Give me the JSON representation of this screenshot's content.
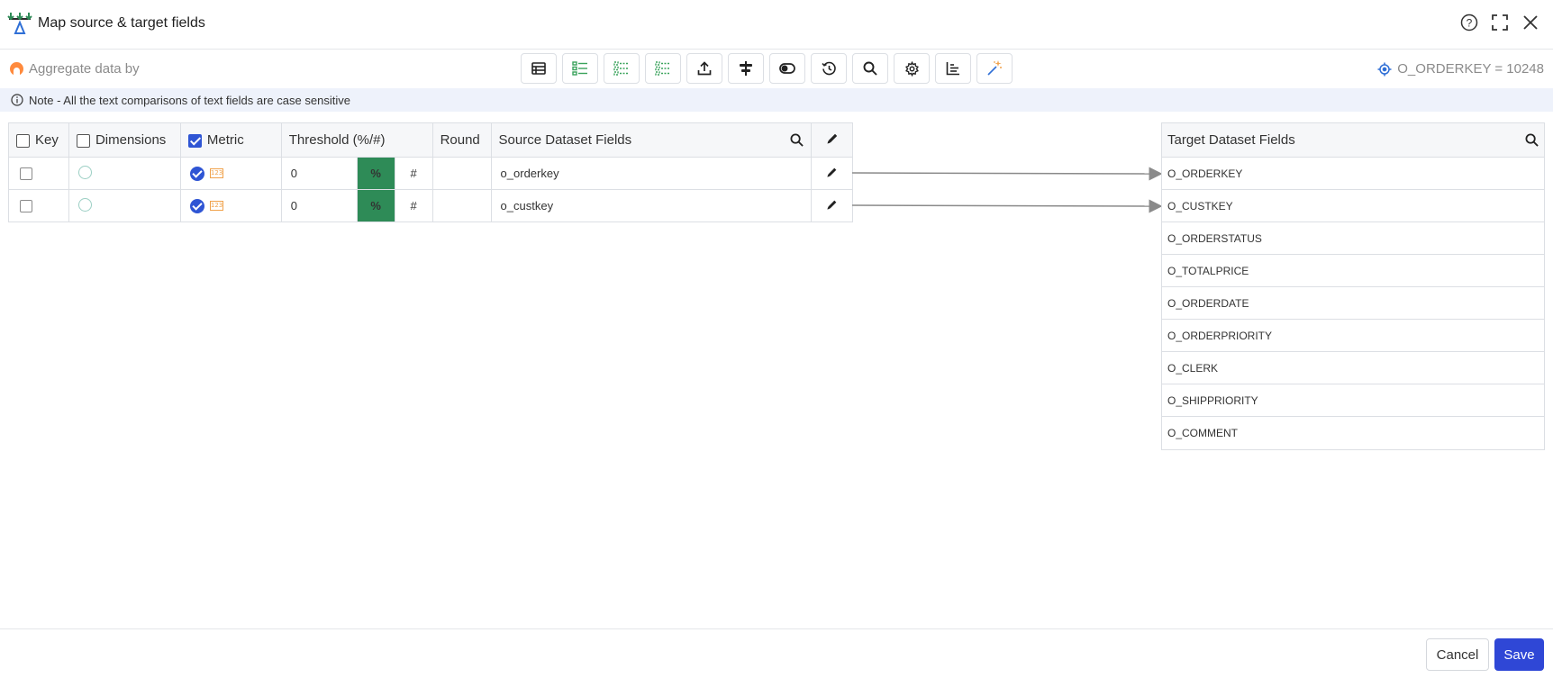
{
  "dialog": {
    "title": "Map source & target fields"
  },
  "toolbar": {
    "aggregate_label": "Aggregate data by",
    "filter_text": "O_ORDERKEY = 10248",
    "tools": [
      "table-icon",
      "list-green-icon",
      "list-dashed-icon",
      "list-dashed-icon",
      "upload-icon",
      "align-center-icon",
      "toggle-icon",
      "history-icon",
      "search-icon",
      "settings-icon",
      "chart-icon",
      "magic-wand-icon"
    ]
  },
  "note": {
    "text": "Note - All the text comparisons of text fields are case sensitive"
  },
  "source": {
    "headers": {
      "key": "Key",
      "dimensions": "Dimensions",
      "metric": "Metric",
      "threshold": "Threshold (%/#)",
      "round": "Round",
      "fields": "Source Dataset Fields"
    },
    "rows": [
      {
        "threshold": "0",
        "pct": "%",
        "hash": "#",
        "field": "o_orderkey"
      },
      {
        "threshold": "0",
        "pct": "%",
        "hash": "#",
        "field": "o_custkey"
      }
    ]
  },
  "target": {
    "header": "Target Dataset Fields",
    "fields": [
      "O_ORDERKEY",
      "O_CUSTKEY",
      "O_ORDERSTATUS",
      "O_TOTALPRICE",
      "O_ORDERDATE",
      "O_ORDERPRIORITY",
      "O_CLERK",
      "O_SHIPPRIORITY",
      "O_COMMENT"
    ]
  },
  "footer": {
    "cancel": "Cancel",
    "save": "Save"
  },
  "colors": {
    "primary": "#2f47d6",
    "percent_bg": "#2e8b57",
    "note_bg": "#eef2fb"
  }
}
